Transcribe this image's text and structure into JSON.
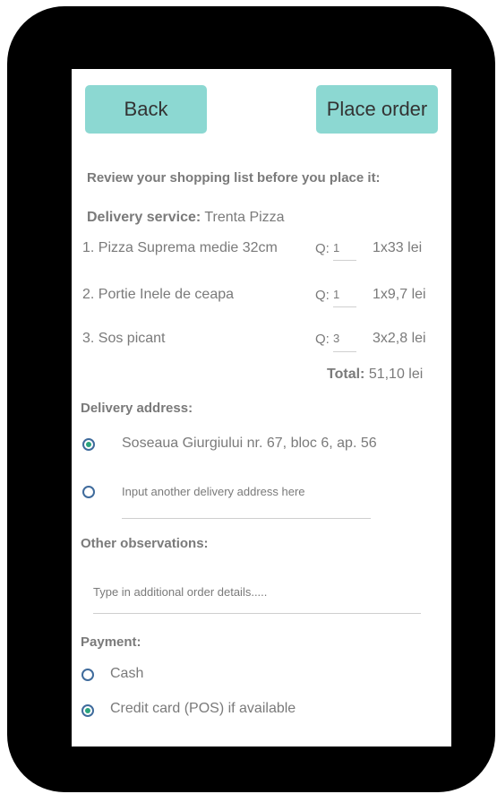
{
  "header": {
    "back_label": "Back",
    "place_order_label": "Place order"
  },
  "review": {
    "intro": "Review your shopping list before you place it:",
    "delivery_service_label": "Delivery service:",
    "delivery_service_value": "Trenta Pizza",
    "items": [
      {
        "name": "1. Pizza Suprema medie 32cm",
        "q_label": "Q:",
        "qty": "1",
        "price": "1x33 lei"
      },
      {
        "name": "2. Portie Inele de ceapa",
        "q_label": "Q:",
        "qty": "1",
        "price": "1x9,7 lei"
      },
      {
        "name": "3. Sos picant",
        "q_label": "Q:",
        "qty": "3",
        "price": "3x2,8 lei"
      }
    ],
    "total_label": "Total:",
    "total_value": "51,10 lei"
  },
  "delivery": {
    "heading": "Delivery address:",
    "saved_address": "Soseaua Giurgiului nr. 67, bloc 6, ap. 56",
    "other_address_placeholder": "Input another delivery address here"
  },
  "observations": {
    "heading": "Other observations:",
    "placeholder": "Type in additional order details....."
  },
  "payment": {
    "heading": "Payment:",
    "options": [
      "Cash",
      "Credit card (POS) if available"
    ],
    "selected": "Credit card (POS) if available"
  },
  "colors": {
    "button": "#8cd8d2",
    "radio_selected": "#2aa37d",
    "radio_border": "#3f6b9c"
  }
}
